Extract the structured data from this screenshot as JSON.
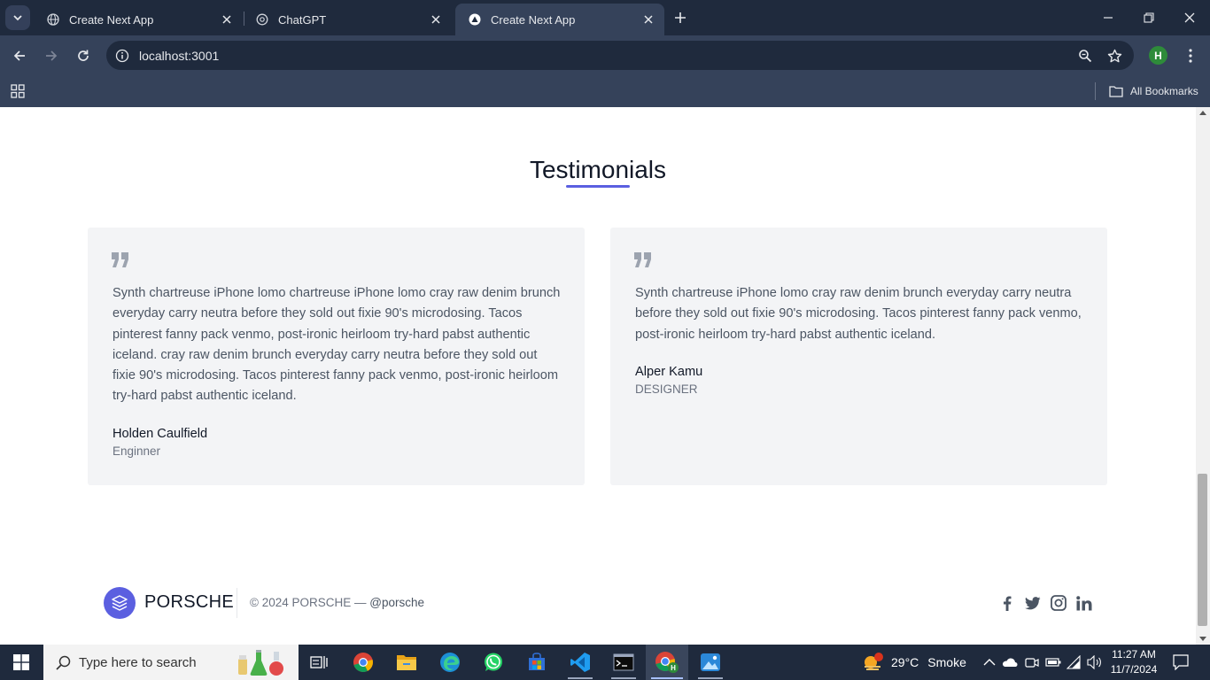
{
  "browser": {
    "tabs": [
      {
        "title": "Create Next App",
        "icon": "globe-icon",
        "active": false
      },
      {
        "title": "ChatGPT",
        "icon": "chatgpt-icon",
        "active": false
      },
      {
        "title": "Create Next App",
        "icon": "nextjs-icon",
        "active": true
      }
    ],
    "url": "localhost:3001",
    "profile_initial": "H",
    "bookmarks_label": "All Bookmarks"
  },
  "page": {
    "section_title": "Testimonials",
    "accent_color": "#5b5fe0",
    "testimonials": [
      {
        "quote": "Synth chartreuse iPhone lomo chartreuse iPhone lomo cray raw denim brunch everyday carry neutra before they sold out fixie 90's microdosing. Tacos pinterest fanny pack venmo, post-ironic heirloom try-hard pabst authentic iceland. cray raw denim brunch everyday carry neutra before they sold out fixie 90's microdosing. Tacos pinterest fanny pack venmo, post-ironic heirloom try-hard pabst authentic iceland.",
        "name": "Holden Caulfield",
        "role": "Enginner"
      },
      {
        "quote": "Synth chartreuse iPhone lomo cray raw denim brunch everyday carry neutra before they sold out fixie 90's microdosing. Tacos pinterest fanny pack venmo, post-ironic heirloom try-hard pabst authentic iceland.",
        "name": "Alper Kamu",
        "role": "DESIGNER"
      }
    ],
    "footer": {
      "brand": "PORSCHE",
      "copyright": "© 2024 PORSCHE —",
      "handle": "@porsche",
      "social": [
        "facebook-icon",
        "twitter-icon",
        "instagram-icon",
        "linkedin-icon"
      ]
    }
  },
  "taskbar": {
    "search_placeholder": "Type here to search",
    "apps": [
      "task-view-icon",
      "chrome-icon",
      "file-explorer-icon",
      "edge-icon",
      "whatsapp-icon",
      "microsoft-store-icon",
      "vscode-icon",
      "terminal-icon",
      "chrome-profile-icon",
      "photos-icon"
    ],
    "weather": {
      "temp": "29°C",
      "condition": "Smoke",
      "badge": "1"
    },
    "time": "11:27 AM",
    "date": "11/7/2024"
  }
}
